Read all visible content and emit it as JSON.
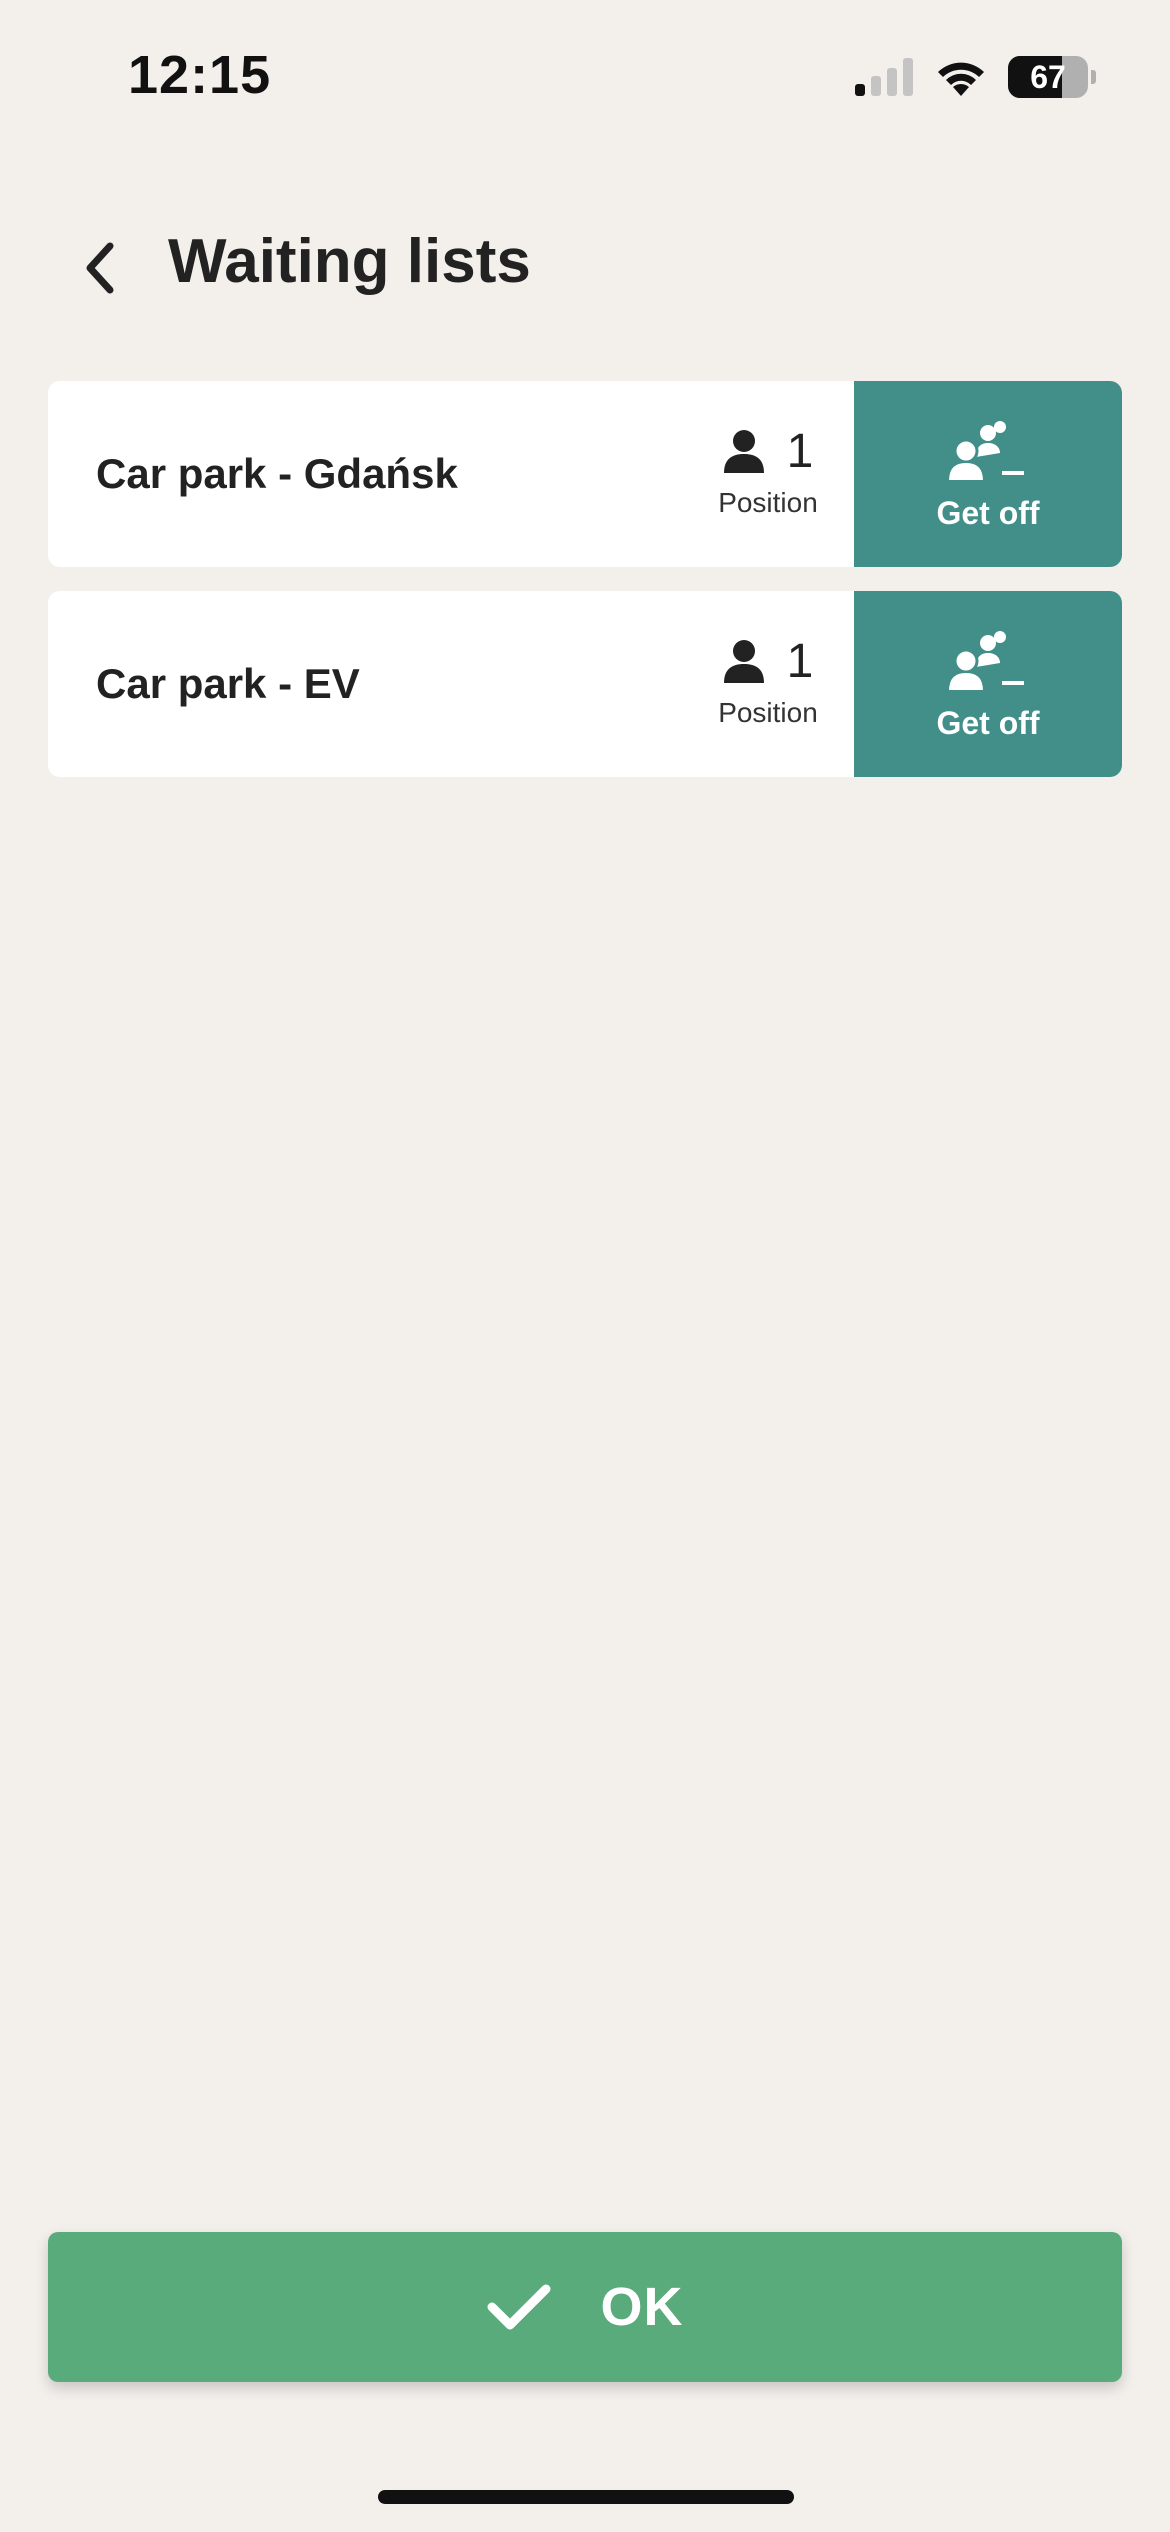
{
  "status_bar": {
    "time": "12:15",
    "battery_level": "67",
    "battery_fraction": 0.67,
    "icons": [
      "signal-icon",
      "wifi-icon",
      "battery-icon"
    ]
  },
  "header": {
    "title": "Waiting lists",
    "back_icon": "chevron-left-icon"
  },
  "waiting_lists": [
    {
      "name": "Car park - Gdańsk",
      "position": "1",
      "position_label": "Position",
      "action_label": "Get off",
      "position_icon": "person-icon",
      "action_icon": "group-remove-icon"
    },
    {
      "name": "Car park - EV",
      "position": "1",
      "position_label": "Position",
      "action_label": "Get off",
      "position_icon": "person-icon",
      "action_icon": "group-remove-icon"
    }
  ],
  "ok_button": {
    "label": "OK",
    "icon": "checkmark-icon"
  },
  "colors": {
    "background": "#f3f0ec",
    "action_teal": "#428f8a",
    "ok_green": "#5aab7c",
    "card": "#ffffff"
  }
}
